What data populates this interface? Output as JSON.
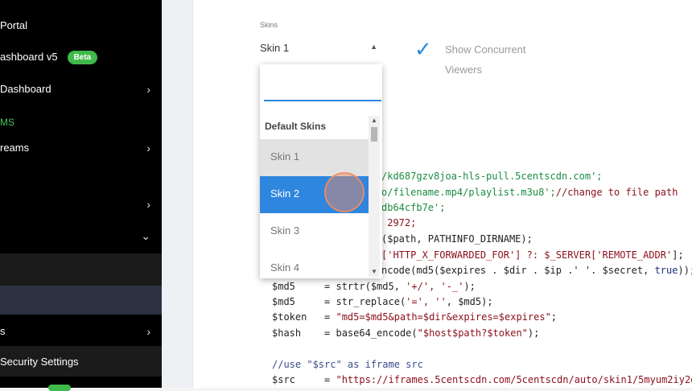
{
  "sidebar": {
    "portal_label": "Portal",
    "dashboard_v5_label": "ashboard v5",
    "beta_badge": "Beta",
    "dashboard_label": "Dashboard",
    "section_label": "MS",
    "streams_label": "reams",
    "s_label": "s",
    "security_label": "Security Settings",
    "chevron_right": "›",
    "chevron_down": "⌄"
  },
  "form": {
    "skins_label": "Skins",
    "selected_skin": "Skin 1",
    "dropdown_arrow": "▲",
    "checkbox_mark": "✓",
    "show_viewers_label": "Show Concurrent Viewers"
  },
  "dropdown": {
    "search_value": "",
    "group_label": "Default Skins",
    "options": [
      "Skin 1",
      "Skin 2",
      "Skin 3",
      "Skin 4"
    ],
    "hovered": "Skin 1",
    "selected": "Skin 2",
    "scroll_up": "▲",
    "scroll_down": "▼"
  },
  "code": {
    "l1": "/kd687gzv8joa-hls-pull.5centscdn.com';",
    "l2a": "o/filename.mp4/playlist.m3u8';",
    "l2b": "//change to file path",
    "l3": "db64cfb7e';",
    "l4": " 2972;",
    "l5": "($path, PATHINFO_DIRNAME);",
    "l6a": "['HTTP_X_FORWARDED_FOR'] ?: $_SERVER[",
    "l6b": "'REMOTE_ADDR'",
    "l6c": "];",
    "l7a": "ncode(md5($expires . $dir . $ip .' '. $secret, ",
    "l7b": "true",
    "l7c": "));",
    "l8a": "$md5     = strtr($md5, ",
    "l8b": "'+/', '-_'",
    "l8c": ");",
    "l9a": "$md5     = str_replace(",
    "l9b": "'=', ''",
    "l9c": ", $md5);",
    "l10a": "$token   = ",
    "l10b": "\"md5=$md5&path=$dir&expires=$expires\"",
    "l10c": ";",
    "l11a": "$hash    = base64_encode(",
    "l11b": "\"$host$path?$token\"",
    "l11c": ");",
    "l12": "//use \"$src\" as iframe src",
    "l13a": "$src     = ",
    "l13b": "\"https://iframes.5centscdn.com/5centscdn/auto/skin1/5myum2iy2e"
  }
}
